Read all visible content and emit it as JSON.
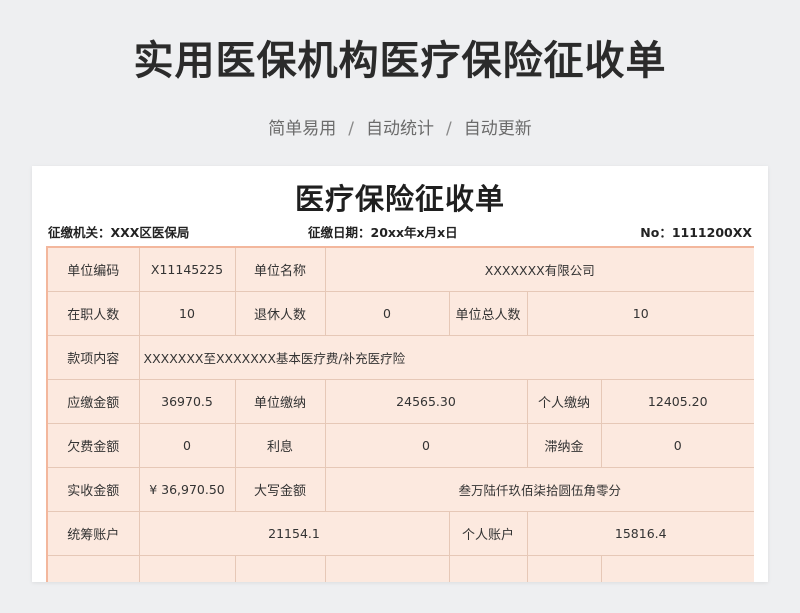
{
  "header": {
    "title": "实用医保机构医疗保险征收单",
    "tags": [
      "简单易用",
      "自动统计",
      "自动更新"
    ],
    "sep": "/"
  },
  "form": {
    "title": "医疗保险征收单",
    "agency": "征缴机关：XXX区医保局",
    "date": "征缴日期：20xx年x月x日",
    "number": "No：1111200XX"
  },
  "rows": {
    "r1": {
      "l1": "单位编码",
      "v1": "X11145225",
      "l2": "单位名称",
      "v2": "XXXXXXX有限公司"
    },
    "r2": {
      "l1": "在职人数",
      "v1": "10",
      "l2": "退休人数",
      "v2": "0",
      "l3": "单位总人数",
      "v3": "10"
    },
    "r3": {
      "l1": "款项内容",
      "v1": "XXXXXXX至XXXXXXX基本医疗费/补充医疗险"
    },
    "r4": {
      "l1": "应缴金额",
      "v1": "36970.5",
      "l2": "单位缴纳",
      "v2": "24565.30",
      "l3": "个人缴纳",
      "v3": "12405.20"
    },
    "r5": {
      "l1": "欠费金额",
      "v1": "0",
      "l2": "利息",
      "v2": "0",
      "l3": "滞纳金",
      "v3": "0"
    },
    "r6": {
      "l1": "实收金额",
      "v1": "¥ 36,970.50",
      "l2": "大写金额",
      "v2": "叁万陆仟玖佰柒拾圆伍角零分"
    },
    "r7": {
      "l1": "统筹账户",
      "v1": "21154.1",
      "l2": "个人账户",
      "v2": "15816.4"
    }
  }
}
